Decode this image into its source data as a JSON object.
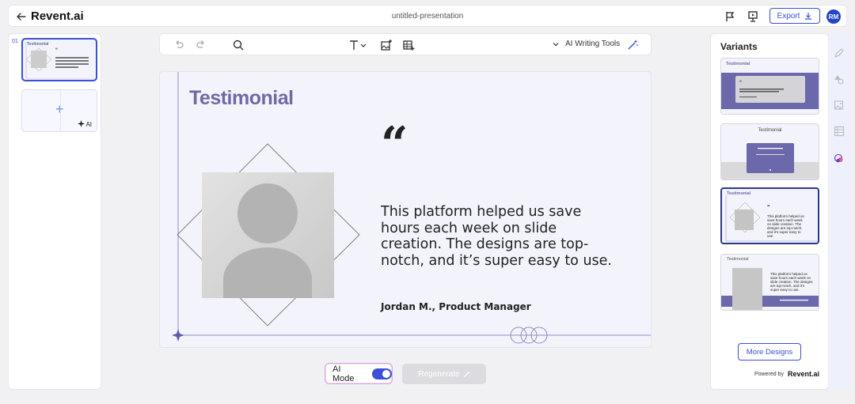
{
  "app": {
    "brand": "Revent.ai",
    "document_title": "untitled-presentation"
  },
  "header": {
    "export_label": "Export",
    "user_initials": "RM"
  },
  "thumbnails": {
    "slide_number": "01",
    "thumb_title": "Testimonial",
    "thumb_quote": "“",
    "add_ai_label": "AI"
  },
  "toolbar": {
    "ai_writing_tools": "AI Writing Tools"
  },
  "slide": {
    "title": "Testimonial",
    "quote_mark": "“",
    "quote": "This platform helped us save hours each week on slide creation. The designs are top-notch, and it’s super easy to use.",
    "author": "Jordan M., Product Manager"
  },
  "controls": {
    "ai_mode_label": "AI Mode",
    "ai_mode_on": true,
    "regenerate_label": "Regenerate"
  },
  "variants": {
    "heading": "Variants",
    "items": [
      {
        "title": "Testimonial",
        "selected": false
      },
      {
        "title": "Testimonial",
        "selected": false
      },
      {
        "title": "Testimonial",
        "selected": true,
        "quote": "This platform helped us save hours each week on slide creation. The designs are top-notch, and it’s super easy to use."
      },
      {
        "title": "Testimonial",
        "selected": false,
        "quote": "This platform helped us save hours each week on slide creation. The designs are top-notch, and it’s super easy to use."
      }
    ],
    "more_designs_label": "More Designs",
    "powered_by": "Powered by",
    "powered_brand": "Revent.ai"
  },
  "colors": {
    "accent": "#3b4fd8",
    "slide_title": "#6d6aa6",
    "variant_band": "#6b68ac",
    "slide_bg": "#f3f3fb"
  }
}
